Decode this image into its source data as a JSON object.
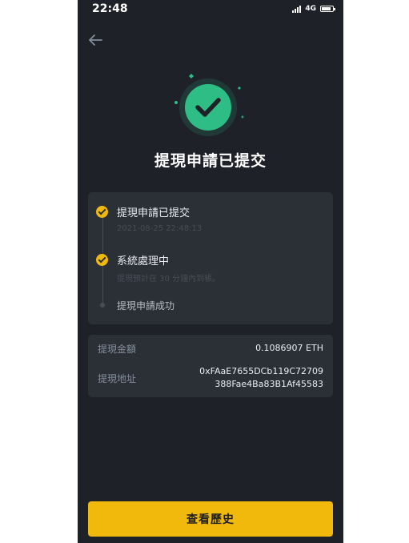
{
  "status_bar": {
    "time": "22:48",
    "network": "4G",
    "battery_level": 0.85
  },
  "header": {
    "back_icon": "arrow-left-icon"
  },
  "success": {
    "icon": "check-circle-icon",
    "title": "提現申請已提交"
  },
  "timeline": {
    "steps": [
      {
        "title": "提現申請已提交",
        "subtitle": "2021-08-25 22:48:13",
        "status": "done"
      },
      {
        "title": "系統處理中",
        "subtitle": "提現預計在 30 分鐘內到帳。",
        "status": "done"
      },
      {
        "title": "提現申請成功",
        "subtitle": "",
        "status": "pending"
      }
    ]
  },
  "details": {
    "amount_label": "提現金額",
    "amount_value": "0.1086907 ETH",
    "address_label": "提現地址",
    "address_line1": "0xFAaE7655DCb119C72709",
    "address_line2": "388Fae4Ba83B1Af45583"
  },
  "actions": {
    "history_label": "查看歷史"
  },
  "colors": {
    "background": "#1f2128",
    "card": "#2b2f36",
    "accent": "#f0b90b",
    "success": "#2ebd85"
  }
}
